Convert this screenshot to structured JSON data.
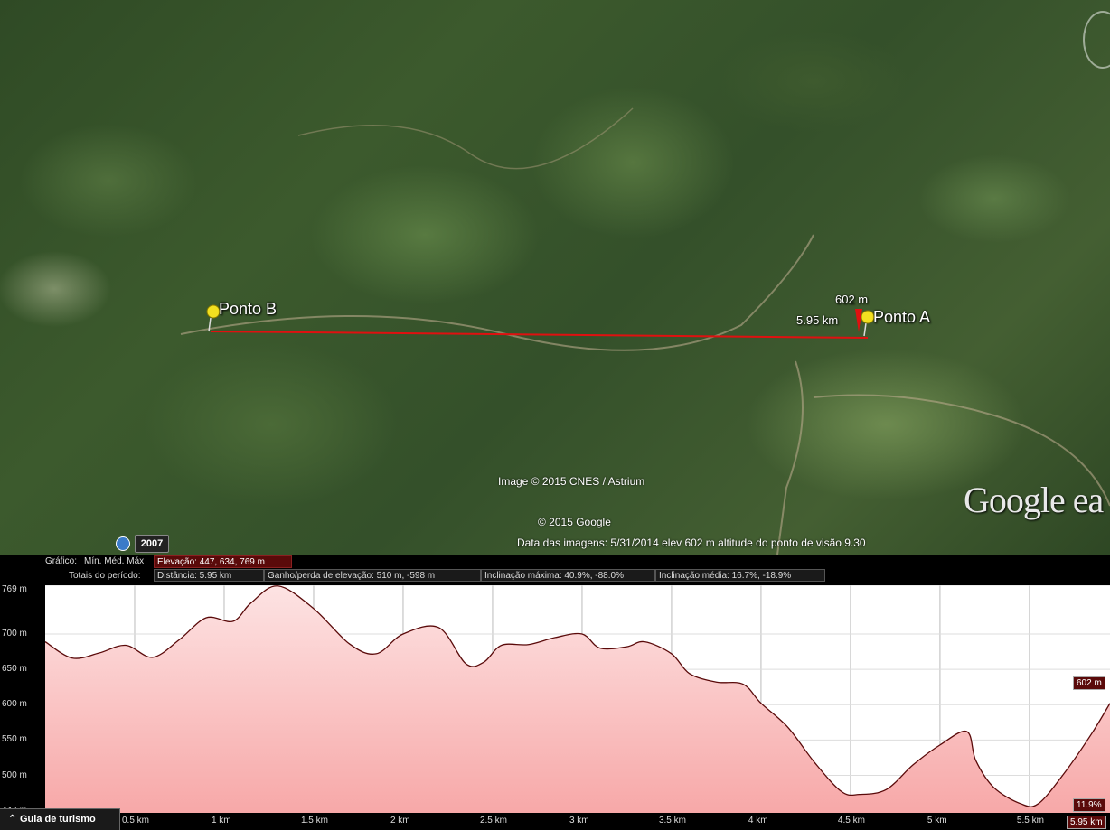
{
  "map": {
    "point_a_label": "Ponto A",
    "point_b_label": "Ponto B",
    "elev_label": "602 m",
    "distance_label": "5.95 km",
    "image_credit": "Image © 2015 CNES / Astrium",
    "google_credit": "© 2015 Google",
    "google_logo": "Google ea",
    "year_badge": "2007",
    "icons": {
      "clock": "clock-icon",
      "pin": "pushpin-icon",
      "compass": "compass-icon"
    }
  },
  "status": {
    "text": "Data das imagens: 5/31/2014        elev   602 m     altitude do ponto de visão   9.30"
  },
  "profile": {
    "row1_key": "Gráfico:",
    "row1_opts": "Mín. Méd. Máx",
    "elevation": "Elevação: 447, 634, 769 m",
    "row2_key": "Totais do período:",
    "distance": "Distância: 5.95 km",
    "gain_loss": "Ganho/perda de elevação: 510 m, -598 m",
    "max_slope": "Inclinação máxima: 40.9%, -88.0%",
    "avg_slope": "Inclinação média: 16.7%, -18.9%",
    "current_elev_badge": "602 m",
    "current_slope_badge": "11.9%",
    "guia": "Guia de turismo"
  },
  "colors": {
    "route": "#e01010",
    "profile_fill": "#f7c0c0",
    "profile_line": "#5a0a0a"
  },
  "chart_data": {
    "type": "area",
    "xlabel": "",
    "ylabel": "",
    "x_ticks": [
      "0.5 km",
      "1 km",
      "1.5 km",
      "2 km",
      "2.5 km",
      "3 km",
      "3.5 km",
      "4 km",
      "4.5 km",
      "5 km",
      "5.5 km",
      "5.95 km"
    ],
    "y_ticks": [
      "769 m",
      "700 m",
      "650 m",
      "600 m",
      "550 m",
      "500 m",
      "447 m"
    ],
    "ylim": [
      447,
      769
    ],
    "xlim": [
      0,
      5.95
    ],
    "x": [
      0,
      0.15,
      0.3,
      0.45,
      0.6,
      0.75,
      0.9,
      1.05,
      1.15,
      1.3,
      1.5,
      1.7,
      1.85,
      2.0,
      2.2,
      2.35,
      2.45,
      2.55,
      2.7,
      2.85,
      3.0,
      3.1,
      3.25,
      3.35,
      3.5,
      3.6,
      3.75,
      3.9,
      4.0,
      4.15,
      4.3,
      4.45,
      4.55,
      4.7,
      4.85,
      5.0,
      5.15,
      5.2,
      5.3,
      5.45,
      5.55,
      5.7,
      5.85,
      5.95
    ],
    "y": [
      689,
      666,
      673,
      684,
      667,
      692,
      723,
      718,
      744,
      768,
      736,
      686,
      672,
      700,
      709,
      658,
      660,
      684,
      685,
      695,
      700,
      680,
      682,
      689,
      672,
      644,
      632,
      629,
      602,
      568,
      518,
      477,
      473,
      480,
      515,
      543,
      562,
      521,
      483,
      460,
      460,
      505,
      560,
      602
    ]
  }
}
